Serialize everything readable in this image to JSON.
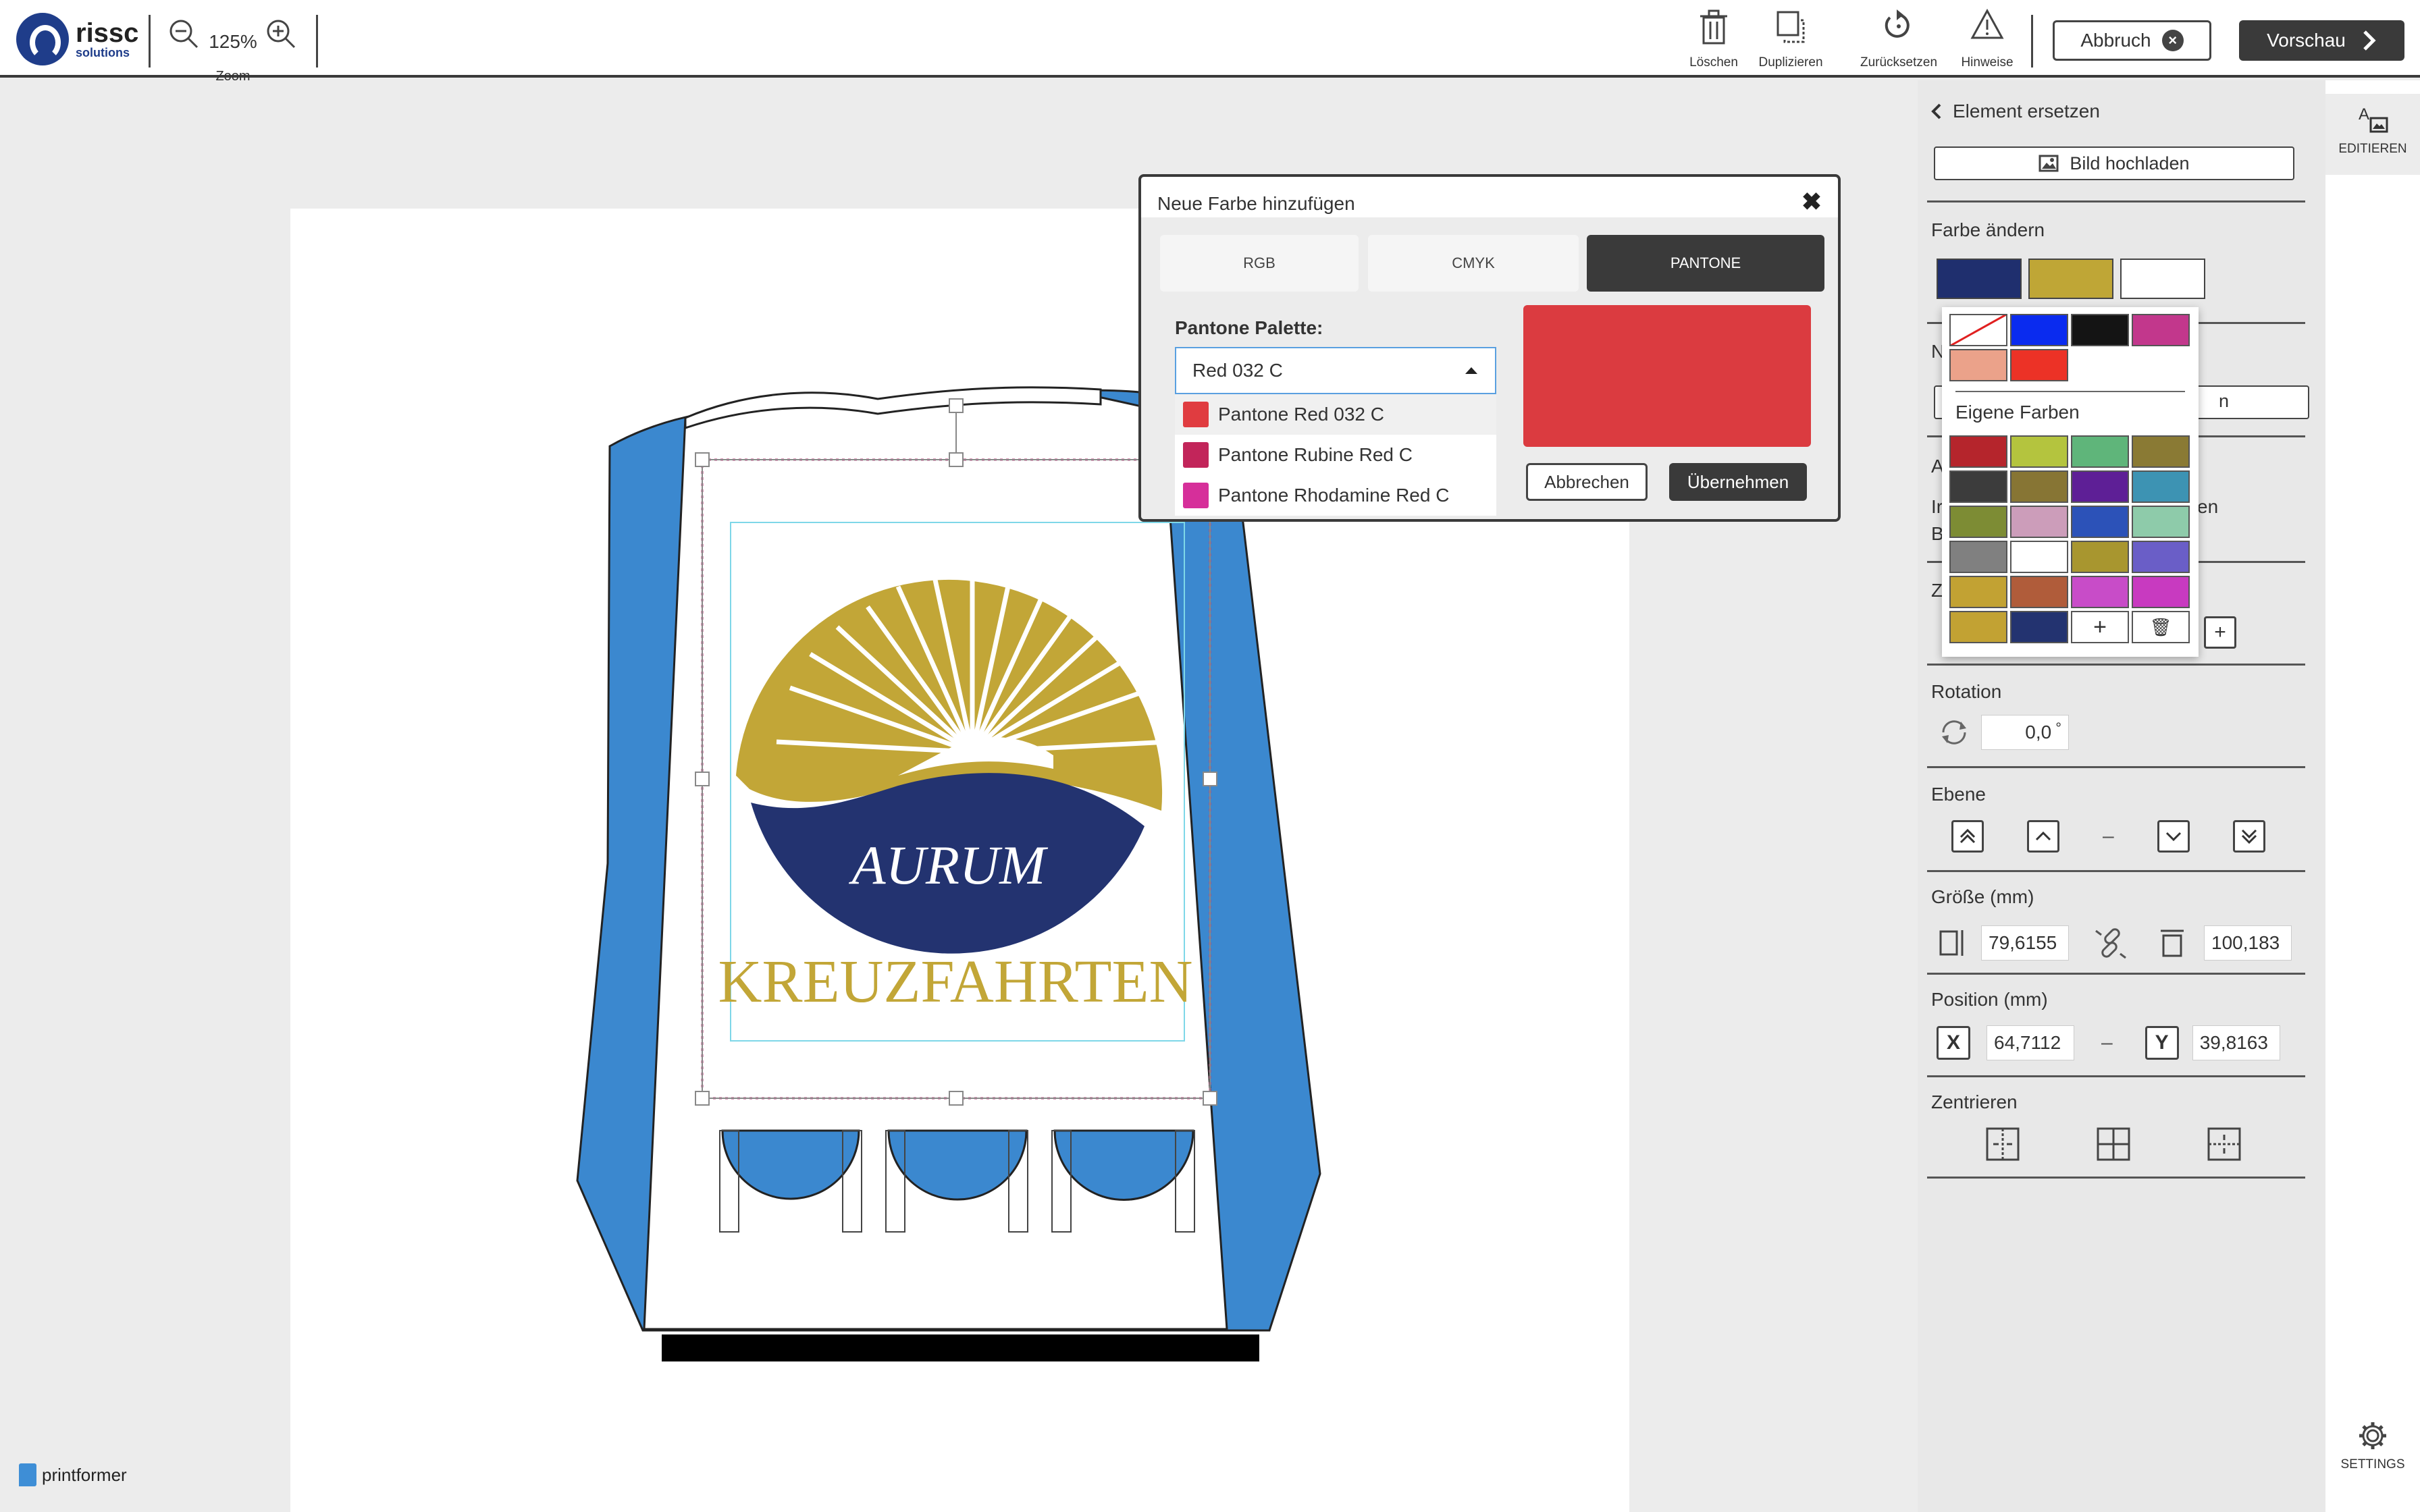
{
  "brand": {
    "name": "rissc",
    "sub": "solutions"
  },
  "zoom": {
    "value": "125%",
    "label": "Zoom",
    "out_icon": "zoom-out-icon",
    "in_icon": "zoom-in-icon"
  },
  "toolbar": {
    "delete": "Löschen",
    "duplicate": "Duplizieren",
    "reset": "Zurücksetzen",
    "hints": "Hinweise",
    "cancel": "Abbruch",
    "preview": "Vorschau"
  },
  "footer": {
    "brand": "printformer"
  },
  "side": {
    "header": "Element ersetzen",
    "upload": "Bild hochladen",
    "color_title": "Farbe ändern",
    "colors": [
      "#1f2f6e",
      "#bfa636",
      "#ffffff"
    ],
    "hidden_n": "N",
    "hidden_a": "A",
    "hidden_i": "Ir",
    "hidden_b": "B",
    "hidden_z": "Z",
    "hidden_en": "en",
    "hidden_n2": "n",
    "rotation_title": "Rotation",
    "rotation_value": "0,0",
    "rotation_unit": "°",
    "ebene_title": "Ebene",
    "size_title": "Größe (mm)",
    "width_value": "79,6155",
    "height_value": "100,183",
    "position_title": "Position (mm)",
    "x_label": "X",
    "y_label": "Y",
    "x_value": "64,7112",
    "y_value": "39,8163",
    "center_title": "Zentrieren"
  },
  "tabs": {
    "edit": "EDITIEREN",
    "settings": "SETTINGS"
  },
  "palette": {
    "basic": [
      "none",
      "#0a2bef",
      "#141414",
      "#c2378c",
      "#eba28a",
      "#ec3226"
    ],
    "own_label": "Eigene Farben",
    "own": [
      "#b5252c",
      "#b4c43e",
      "#5fb57a",
      "#8a7a34",
      "#3c3c3c",
      "#877534",
      "#5e1f96",
      "#3d93b3",
      "#7d8c34",
      "#cc9dba",
      "#2c52b8",
      "#8ecbaa",
      "#808080",
      "#ffffff",
      "#a8962f",
      "#6a5ec7",
      "#c2a233",
      "#b05c3a",
      "#c84cc8",
      "#c83ac0",
      "#c2a233",
      "#233370"
    ],
    "add_label": "+",
    "delete_label": "🗑"
  },
  "dialog": {
    "title": "Neue Farbe hinzufügen",
    "close": "✖",
    "tabs": [
      "RGB",
      "CMYK",
      "PANTONE"
    ],
    "active_tab": "PANTONE",
    "palette_label": "Pantone Palette:",
    "selected": "Red 032 C",
    "options": [
      {
        "label": "Pantone Red 032 C",
        "color": "#e03c40"
      },
      {
        "label": "Pantone Rubine Red C",
        "color": "#c2255a"
      },
      {
        "label": "Pantone Rhodamine Red C",
        "color": "#d62f9a"
      }
    ],
    "preview_color": "#db3b40",
    "cancel": "Abbrechen",
    "apply": "Übernehmen"
  },
  "design": {
    "logo_word": "AURUM",
    "logo_sub": "KREUZFAHRTEN"
  }
}
